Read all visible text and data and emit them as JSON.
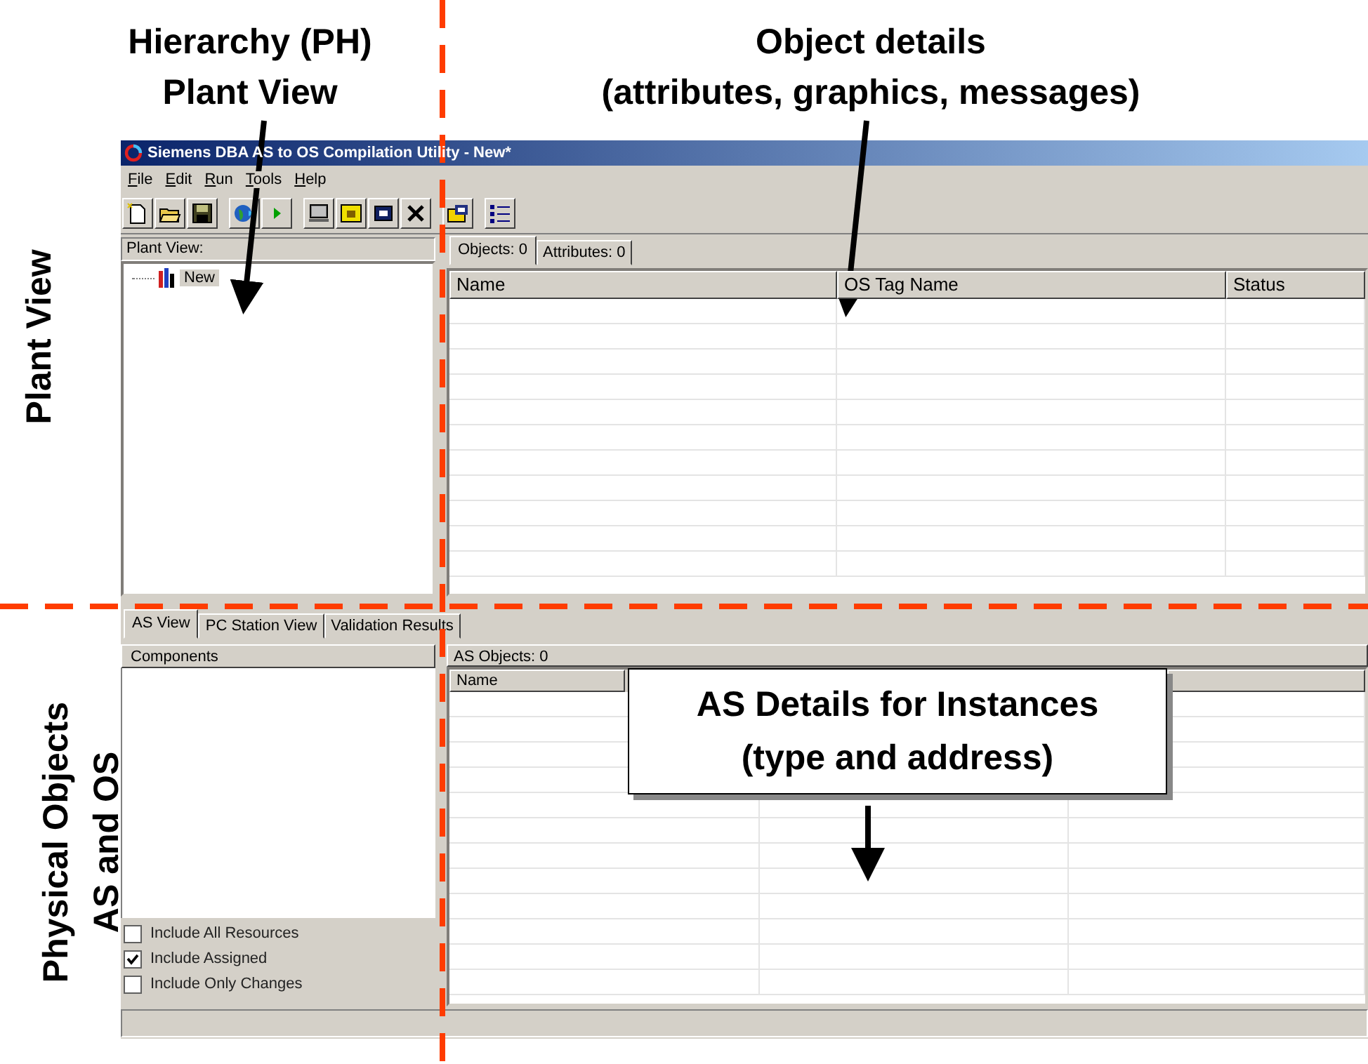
{
  "annotations": {
    "headings": [
      {
        "lines": [
          "Hierarchy (PH)",
          "Plant View"
        ]
      },
      {
        "lines": [
          "Object details",
          "(attributes, graphics, messages)"
        ]
      }
    ],
    "side_labels": [
      {
        "lines": [
          "Plant View"
        ]
      },
      {
        "lines": [
          "Physical Objects",
          "AS and OS"
        ]
      }
    ],
    "callout": {
      "lines": [
        "AS Details for Instances",
        "(type and address)"
      ]
    }
  },
  "window": {
    "title": "Siemens DBA AS to OS Compilation Utility - New*",
    "menu": [
      "File",
      "Edit",
      "Run",
      "Tools",
      "Help"
    ],
    "plant_view": {
      "header": "Plant View:",
      "tree": [
        {
          "label": "New",
          "selected": true
        }
      ]
    },
    "object_tabs": [
      {
        "label": "Objects: 0",
        "selected": true
      },
      {
        "label": "Attributes: 0",
        "selected": false
      }
    ],
    "object_table": {
      "columns": [
        "Name",
        "OS Tag Name",
        "Status"
      ]
    },
    "lower_tabs": [
      {
        "label": "AS View",
        "selected": true
      },
      {
        "label": "PC Station View",
        "selected": false
      },
      {
        "label": "Validation Results",
        "selected": false
      }
    ],
    "components": {
      "header": "Components"
    },
    "options": [
      {
        "label": "Include All Resources",
        "checked": false
      },
      {
        "label": "Include Assigned",
        "checked": true
      },
      {
        "label": "Include Only Changes",
        "checked": false
      }
    ],
    "as_objects": {
      "label": "AS Objects: 0",
      "columns": [
        "Name"
      ]
    }
  }
}
